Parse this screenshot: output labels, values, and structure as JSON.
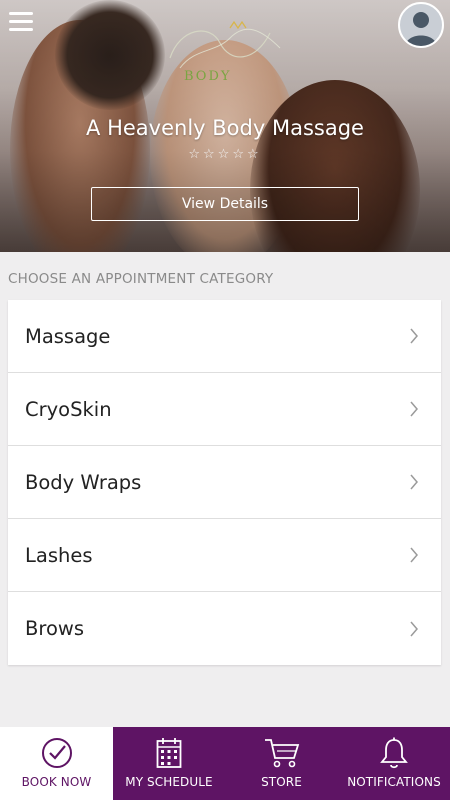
{
  "header": {
    "business_name": "A Heavenly Body Massage",
    "rating_stars": "☆☆☆☆☆",
    "view_details_label": "View Details",
    "logo_text": "BODY",
    "menu_icon": "hamburger-menu-icon",
    "avatar_icon": "user-avatar-icon"
  },
  "section": {
    "heading": "CHOOSE AN APPOINTMENT CATEGORY"
  },
  "categories": [
    {
      "label": "Massage"
    },
    {
      "label": "CryoSkin"
    },
    {
      "label": "Body Wraps"
    },
    {
      "label": "Lashes"
    },
    {
      "label": "Brows"
    }
  ],
  "bottom_nav": {
    "items": [
      {
        "label": "BOOK NOW",
        "icon": "checkmark-circle-icon",
        "active": true
      },
      {
        "label": "MY SCHEDULE",
        "icon": "calendar-icon",
        "active": false
      },
      {
        "label": "STORE",
        "icon": "cart-icon",
        "active": false
      },
      {
        "label": "NOTIFICATIONS",
        "icon": "bell-icon",
        "active": false
      }
    ]
  },
  "colors": {
    "brand_purple": "#5e1464",
    "background": "#efeeef",
    "heading_gray": "#8a8a8a"
  }
}
